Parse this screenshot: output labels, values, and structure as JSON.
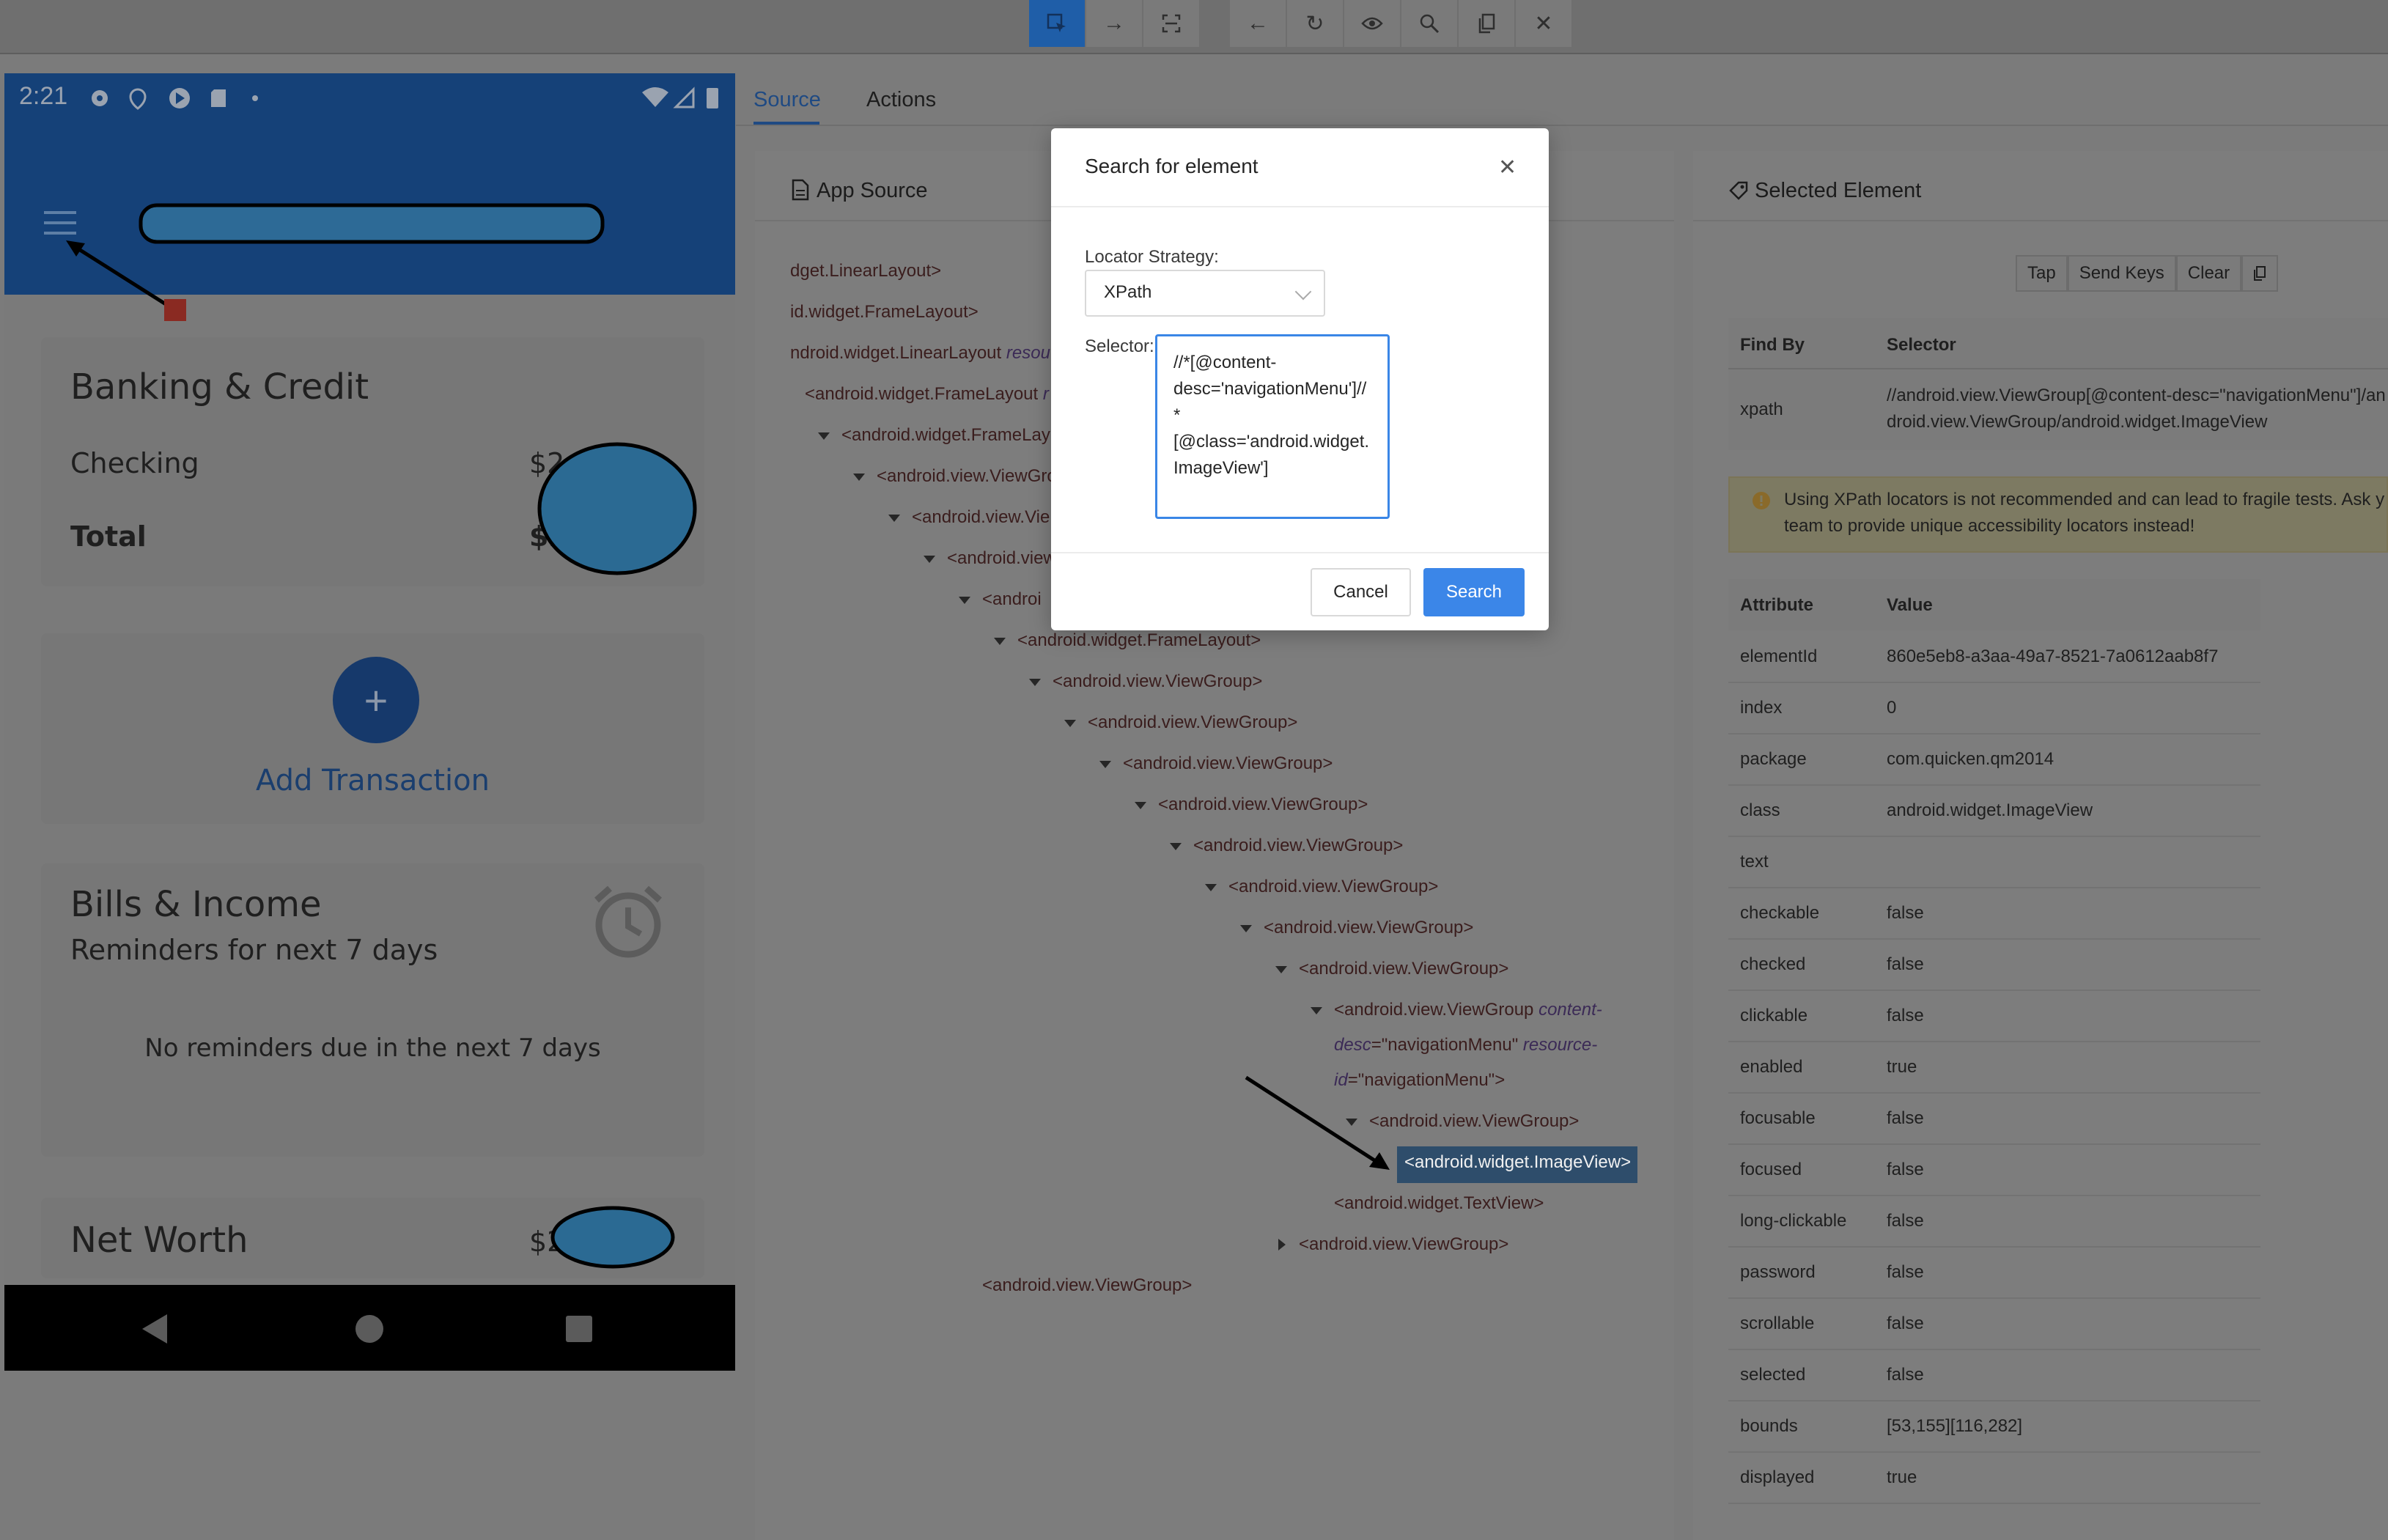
{
  "toolbar": {
    "buttons": [
      "select-element",
      "swipe",
      "tap-by-coordinates",
      "back",
      "refresh",
      "toggle-attributes",
      "search",
      "copy-xml",
      "quit-session"
    ]
  },
  "device": {
    "time": "2:21",
    "banking": {
      "title": "Banking & Credit",
      "checking_label": "Checking",
      "checking_value": "$2",
      "total_label": "Total",
      "total_value": "$2"
    },
    "add_transaction": {
      "plus": "+",
      "label": "Add Transaction"
    },
    "bills": {
      "title": "Bills & Income",
      "subtitle": "Reminders for next 7 days",
      "empty": "No reminders due in the next 7 days"
    },
    "net_worth": {
      "label": "Net Worth",
      "value": "$2"
    }
  },
  "tabs": {
    "source": "Source",
    "actions": "Actions"
  },
  "source_panel": {
    "title": "App Source",
    "nodes": [
      {
        "text": "dget.LinearLayout>"
      },
      {
        "text": "id.widget.FrameLayout>"
      },
      {
        "text": "ndroid.widget.LinearLayout ",
        "attr": "resou"
      },
      {
        "text": "<android.widget.FrameLayout ",
        "attr": "r"
      },
      {
        "text": "<android.widget.FrameLay"
      },
      {
        "text": "<android.view.ViewGro"
      },
      {
        "text": "<android.view.Vie"
      },
      {
        "text": "<android.view"
      },
      {
        "text": "<androi"
      },
      {
        "text": "<android.widget.FrameLayout>"
      },
      {
        "text": "<android.view.ViewGroup>"
      },
      {
        "text": "<android.view.ViewGroup>"
      },
      {
        "text": "<android.view.ViewGroup>"
      },
      {
        "text": "<android.view.ViewGroup>"
      },
      {
        "text": "<android.view.ViewGroup>"
      },
      {
        "text": "<android.view.ViewGroup>"
      },
      {
        "text": "<android.view.ViewGroup>"
      },
      {
        "text": "<android.view.ViewGroup>"
      },
      {
        "text": "<android.view.ViewGroup ",
        "attr": "content-"
      },
      {
        "text": "",
        "attr": "desc",
        "tail": "=\"navigationMenu\" ",
        "attr2": "resource-"
      },
      {
        "text": "",
        "attr": "id",
        "tail": "=\"navigationMenu\">"
      },
      {
        "text": "<android.view.ViewGroup>"
      },
      {
        "text": "<android.widget.ImageView>"
      },
      {
        "text": "<android.widget.TextView>"
      },
      {
        "text": "<android.view.ViewGroup>"
      },
      {
        "text": "<android.view.ViewGroup>"
      }
    ]
  },
  "selected_panel": {
    "title": "Selected Element",
    "buttons": {
      "tap": "Tap",
      "send_keys": "Send Keys",
      "clear": "Clear"
    },
    "find_by_header": "Find By",
    "selector_header": "Selector",
    "find_by": "xpath",
    "selector_line1": "//android.view.ViewGroup[@content-desc=\"navigationMenu\"]/an",
    "selector_line2": "droid.view.ViewGroup/android.widget.ImageView",
    "warning_line1": "Using XPath locators is not recommended and can lead to fragile tests. Ask y",
    "warning_line2": "team to provide unique accessibility locators instead!",
    "attr_header": "Attribute",
    "value_header": "Value",
    "attributes": [
      {
        "name": "elementId",
        "value": "860e5eb8-a3aa-49a7-8521-7a0612aab8f7"
      },
      {
        "name": "index",
        "value": "0"
      },
      {
        "name": "package",
        "value": "com.quicken.qm2014"
      },
      {
        "name": "class",
        "value": "android.widget.ImageView"
      },
      {
        "name": "text",
        "value": ""
      },
      {
        "name": "checkable",
        "value": "false"
      },
      {
        "name": "checked",
        "value": "false"
      },
      {
        "name": "clickable",
        "value": "false"
      },
      {
        "name": "enabled",
        "value": "true"
      },
      {
        "name": "focusable",
        "value": "false"
      },
      {
        "name": "focused",
        "value": "false"
      },
      {
        "name": "long-clickable",
        "value": "false"
      },
      {
        "name": "password",
        "value": "false"
      },
      {
        "name": "scrollable",
        "value": "false"
      },
      {
        "name": "selected",
        "value": "false"
      },
      {
        "name": "bounds",
        "value": "[53,155][116,282]"
      },
      {
        "name": "displayed",
        "value": "true"
      }
    ]
  },
  "modal": {
    "title": "Search for element",
    "strategy_label": "Locator Strategy:",
    "strategy_value": "XPath",
    "selector_label": "Selector:",
    "selector_value": "//*[@content-desc='navigationMenu']//*[@class='android.widget.ImageView']",
    "cancel": "Cancel",
    "search": "Search"
  },
  "colors": {
    "accent": "#3b86e8",
    "overlay": "#7b7b7b",
    "app_bar": "#154178"
  }
}
